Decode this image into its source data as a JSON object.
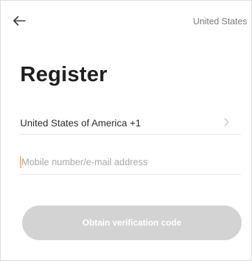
{
  "header": {
    "back_icon": "arrow-left-icon",
    "region": "United States"
  },
  "page": {
    "title": "Register"
  },
  "country_selector": {
    "label": "United States of America +1",
    "chevron_icon": "chevron-right-icon"
  },
  "account_input": {
    "value": "",
    "placeholder": "Mobile number/e-mail address"
  },
  "obtain_code_button": {
    "label": "Obtain verification code",
    "state": "disabled"
  },
  "colors": {
    "button_disabled": "#d3d3d3",
    "cursor_accent": "#e89a3c",
    "divider": "#e6e6e6",
    "placeholder": "#a9a9a9"
  }
}
